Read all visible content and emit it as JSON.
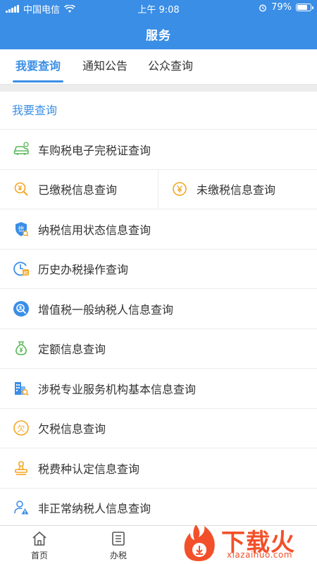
{
  "status_bar": {
    "carrier": "中国电信",
    "time": "上午 9:08",
    "battery": "79%",
    "battery_level": 0.79
  },
  "nav": {
    "title": "服务"
  },
  "tabs": [
    {
      "label": "我要查询",
      "active": true
    },
    {
      "label": "通知公告",
      "active": false
    },
    {
      "label": "公众查询",
      "active": false
    }
  ],
  "section": {
    "title": "我要查询"
  },
  "items": [
    {
      "label": "车购税电子完税证查询",
      "icon": "car-icon"
    },
    {
      "label": "已缴税信息查询",
      "icon": "yen-search-icon"
    },
    {
      "label": "未缴税信息查询",
      "icon": "yen-coin-icon"
    },
    {
      "label": "纳税信用状态信息查询",
      "icon": "credit-shield-icon"
    },
    {
      "label": "历史办税操作查询",
      "icon": "clock-tax-icon"
    },
    {
      "label": "增值税一般纳税人信息查询",
      "icon": "person-search-icon"
    },
    {
      "label": "定额信息查询",
      "icon": "money-bag-icon"
    },
    {
      "label": "涉税专业服务机构基本信息查询",
      "icon": "building-search-icon"
    },
    {
      "label": "欠税信息查询",
      "icon": "owe-tax-icon"
    },
    {
      "label": "税费种认定信息查询",
      "icon": "seal-icon"
    },
    {
      "label": "非正常纳税人信息查询",
      "icon": "person-warning-icon"
    }
  ],
  "bottom_nav": [
    {
      "label": "首页",
      "icon": "home-icon"
    },
    {
      "label": "办税",
      "icon": "list-icon"
    }
  ],
  "watermark": {
    "title": "下载火",
    "subtitle": "xiazaihuo.com"
  },
  "colors": {
    "primary": "#3a8ee6",
    "accent_orange": "#f5a623",
    "accent_green": "#5cb85c",
    "watermark": "#f2502a"
  }
}
